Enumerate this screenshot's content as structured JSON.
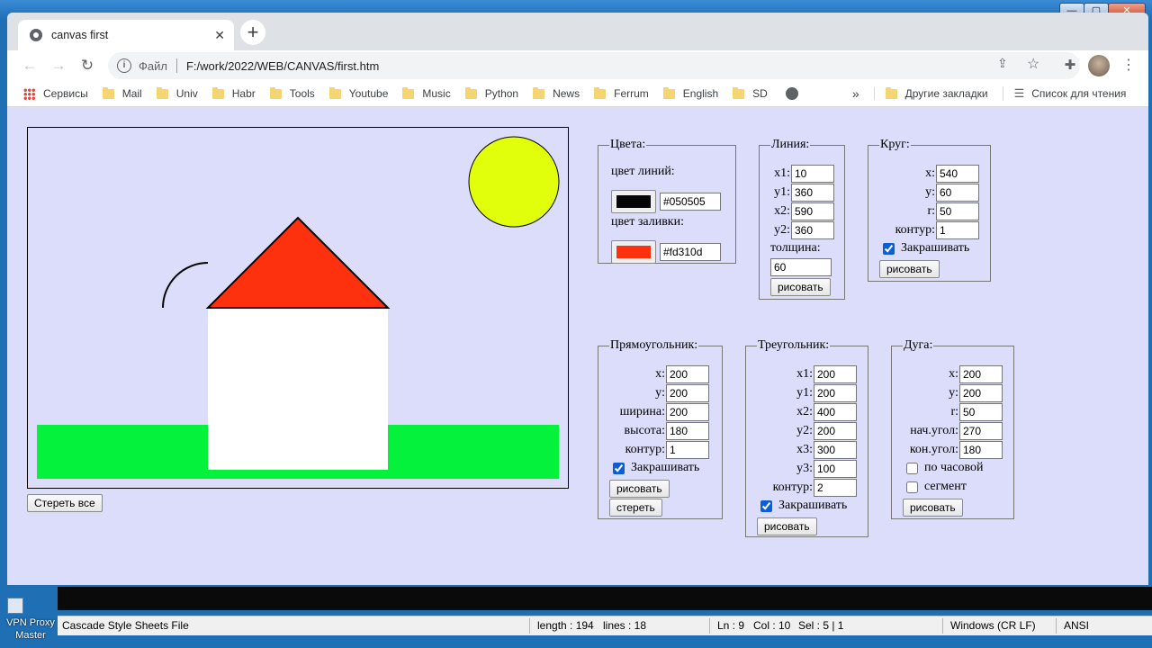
{
  "window": {
    "minimize": "—",
    "maximize": "▢",
    "close": "✕"
  },
  "tab": {
    "title": "canvas first",
    "close": "✕",
    "new_tab": "+"
  },
  "toolbar": {
    "file_label": "Файл",
    "url": "F:/work/2022/WEB/CANVAS/first.htm"
  },
  "bookmarks": {
    "apps": "Сервисы",
    "items": [
      "Mail",
      "Univ",
      "Habr",
      "Tools",
      "Youtube",
      "Music",
      "Python",
      "News",
      "Ferrum",
      "English",
      "SD"
    ],
    "more": "»",
    "other": "Другие закладки",
    "reading_list": "Список для чтения"
  },
  "colors_panel": {
    "legend": "Цвета:",
    "line_label": "цвет линий:",
    "line_color": "#050505",
    "fill_label": "цвет заливки:",
    "fill_color": "#fd310d"
  },
  "line_panel": {
    "legend": "Линия:",
    "x1_label": "x1:",
    "x1": "10",
    "y1_label": "y1:",
    "y1": "360",
    "x2_label": "x2:",
    "x2": "590",
    "y2_label": "y2:",
    "y2": "360",
    "width_label": "толщина:",
    "width": "60",
    "draw": "рисовать"
  },
  "circle_panel": {
    "legend": "Круг:",
    "x_label": "x:",
    "x": "540",
    "y_label": "y:",
    "y": "60",
    "r_label": "r:",
    "r": "50",
    "outline_label": "контур:",
    "outline": "1",
    "fill_label": "Закрашивать",
    "fill": true,
    "draw": "рисовать"
  },
  "rect_panel": {
    "legend": "Прямоугольник:",
    "x_label": "x:",
    "x": "200",
    "y_label": "y:",
    "y": "200",
    "w_label": "ширина:",
    "w": "200",
    "h_label": "высота:",
    "h": "180",
    "outline_label": "контур:",
    "outline": "1",
    "fill_label": "Закрашивать",
    "fill": true,
    "draw": "рисовать",
    "erase": "стереть"
  },
  "triangle_panel": {
    "legend": "Треугольник:",
    "x1_label": "x1:",
    "x1": "200",
    "y1_label": "y1:",
    "y1": "200",
    "x2_label": "x2:",
    "x2": "400",
    "y2_label": "y2:",
    "y2": "200",
    "x3_label": "x3:",
    "x3": "300",
    "y3_label": "y3:",
    "y3": "100",
    "outline_label": "контур:",
    "outline": "2",
    "fill_label": "Закрашивать",
    "fill": true,
    "draw": "рисовать"
  },
  "arc_panel": {
    "legend": "Дуга:",
    "x_label": "x:",
    "x": "200",
    "y_label": "y:",
    "y": "200",
    "r_label": "r:",
    "r": "50",
    "start_label": "нач.угол:",
    "start": "270",
    "end_label": "кон.угол:",
    "end": "180",
    "clockwise_label": "по часовой",
    "clockwise": false,
    "segment_label": "сегмент",
    "segment": false,
    "draw": "рисовать"
  },
  "clear_all": "Стереть все",
  "scene": {
    "sun_color": "#e1ff0a",
    "roof_color": "#fd310d",
    "house_color": "#ffffff",
    "grass_color": "#05f23c",
    "outline_color": "#050505"
  },
  "taskbar": {
    "desktop_label": "VPN Proxy Master"
  },
  "editor_status": {
    "file_type": "Cascade Style Sheets File",
    "length": "length : 194",
    "lines": "lines : 18",
    "ln": "Ln : 9",
    "col": "Col : 10",
    "sel": "Sel : 5 | 1",
    "eol": "Windows (CR LF)",
    "encoding": "ANSI"
  }
}
